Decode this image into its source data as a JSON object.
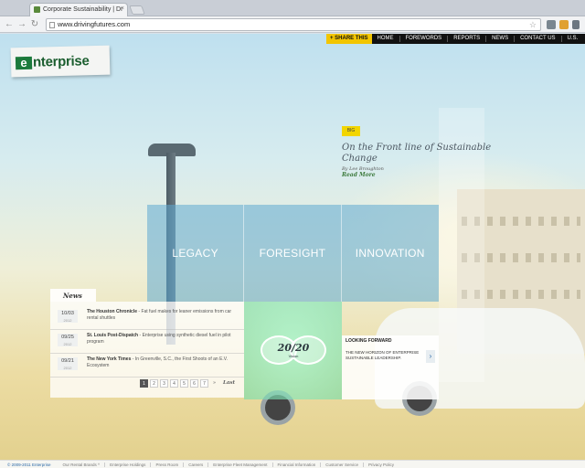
{
  "browser": {
    "tab_title": "Corporate Sustainability | Dr",
    "tab_close": "×",
    "url": "www.drivingfutures.com",
    "back": "←",
    "forward": "→",
    "reload": "↻",
    "star": "☆"
  },
  "logo": {
    "mark": "e",
    "text": "nterprise"
  },
  "topnav": {
    "share_label": "+ SHARE THIS",
    "items": [
      "HOME",
      "FOREWORDS",
      "REPORTS",
      "NEWS",
      "CONTACT US",
      "U.S."
    ]
  },
  "feature": {
    "tag": "BIG",
    "title": "On the Front line of Sustainable Change",
    "byline": "By Lee Broughton",
    "read_more": "Read More"
  },
  "pillars": [
    "LEGACY",
    "FORESIGHT",
    "INNOVATION"
  ],
  "vision": {
    "number": "20/20",
    "label": "Vision"
  },
  "looking_forward": {
    "title": "LOOKING FORWARD",
    "description": "THE NEW HORIZON OF ENTERPRISE SUSTAINABLE LEADERSHIP.",
    "arrow": "›"
  },
  "news": {
    "tab_label": "News",
    "items": [
      {
        "date": "10/03",
        "year": "2012",
        "source": "The Houston Chronicle",
        "text": " - Fat fuel makes for leaner emissions from car rental shuttles"
      },
      {
        "date": "09/25",
        "year": "2012",
        "source": "St. Louis Post-Dispatch",
        "text": " - Enterprise using synthetic diesel fuel in pilot program"
      },
      {
        "date": "09/21",
        "year": "2012",
        "source": "The New York Times",
        "text": " - In Greenville, S.C., the First Shoots of an E.V. Ecosystem"
      }
    ],
    "pages": [
      "1",
      "2",
      "3",
      "4",
      "5",
      "6",
      "7"
    ],
    "next": "»",
    "last": "Last"
  },
  "footer": {
    "copyright": "© 2009-2011 Enterprise",
    "links": [
      "Our Rental Brands ^",
      "Enterprise Holdings",
      "Press Room",
      "Careers",
      "Enterprise Fleet Management",
      "Financial Information",
      "Customer Service",
      "Privacy Policy"
    ]
  },
  "colors": {
    "brand_green": "#1c7a3c",
    "share_yellow": "#f2c500",
    "pillar_blue": "#5faad2",
    "vision_green": "#64dca8"
  }
}
